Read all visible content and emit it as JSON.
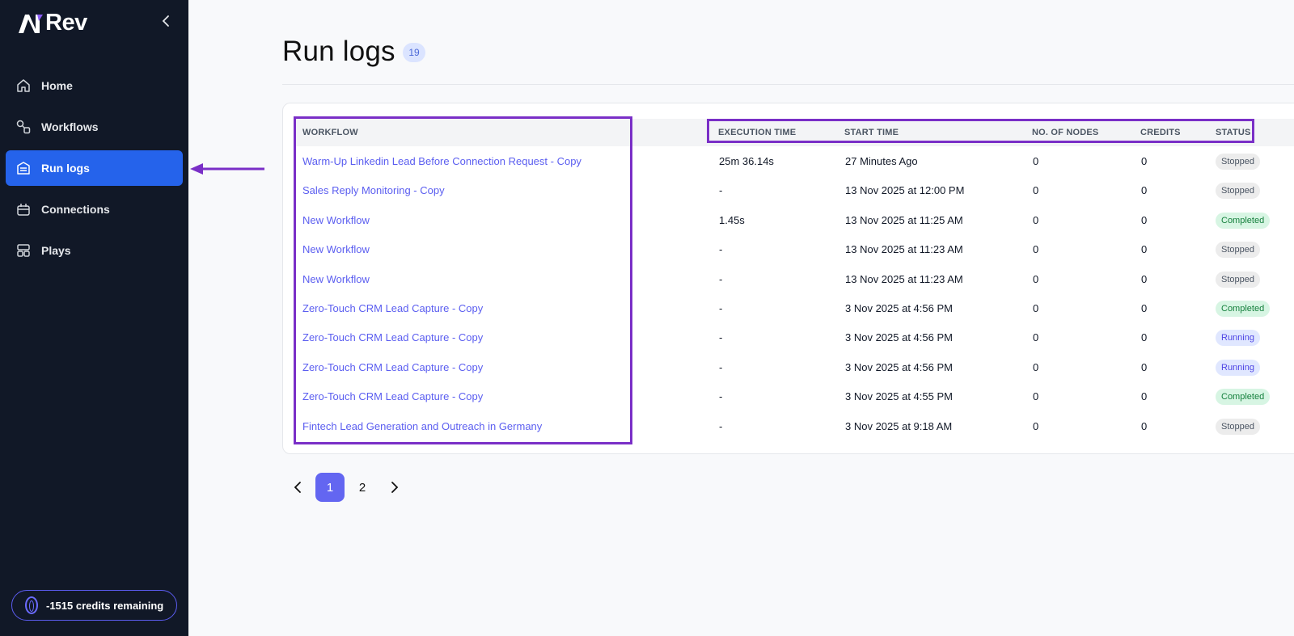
{
  "app": {
    "logo_text": "Rev"
  },
  "sidebar": {
    "items": [
      {
        "label": "Home",
        "icon": "home-icon"
      },
      {
        "label": "Workflows",
        "icon": "workflow-icon"
      },
      {
        "label": "Run logs",
        "icon": "run-logs-icon",
        "active": true
      },
      {
        "label": "Connections",
        "icon": "connections-icon"
      },
      {
        "label": "Plays",
        "icon": "plays-icon"
      }
    ],
    "credits_label": "-1515 credits remaining"
  },
  "header": {
    "title": "Run logs",
    "count": "19"
  },
  "table": {
    "columns": [
      "WORKFLOW",
      "EXECUTION TIME",
      "START TIME",
      "NO. OF NODES",
      "CREDITS",
      "STATUS"
    ],
    "rows": [
      {
        "workflow": "Warm-Up Linkedin Lead Before Connection Request - Copy",
        "execution_time": "25m 36.14s",
        "start_time": "27 Minutes Ago",
        "nodes": "0",
        "credits": "0",
        "status": "Stopped"
      },
      {
        "workflow": "Sales Reply Monitoring - Copy",
        "execution_time": "-",
        "start_time": "13 Nov 2025 at 12:00 PM",
        "nodes": "0",
        "credits": "0",
        "status": "Stopped"
      },
      {
        "workflow": "New Workflow",
        "execution_time": "1.45s",
        "start_time": "13 Nov 2025 at 11:25 AM",
        "nodes": "0",
        "credits": "0",
        "status": "Completed"
      },
      {
        "workflow": "New Workflow",
        "execution_time": "-",
        "start_time": "13 Nov 2025 at 11:23 AM",
        "nodes": "0",
        "credits": "0",
        "status": "Stopped"
      },
      {
        "workflow": "New Workflow",
        "execution_time": "-",
        "start_time": "13 Nov 2025 at 11:23 AM",
        "nodes": "0",
        "credits": "0",
        "status": "Stopped"
      },
      {
        "workflow": "Zero-Touch CRM Lead Capture - Copy",
        "execution_time": "-",
        "start_time": "3 Nov 2025 at 4:56 PM",
        "nodes": "0",
        "credits": "0",
        "status": "Completed"
      },
      {
        "workflow": "Zero-Touch CRM Lead Capture - Copy",
        "execution_time": "-",
        "start_time": "3 Nov 2025 at 4:56 PM",
        "nodes": "0",
        "credits": "0",
        "status": "Running"
      },
      {
        "workflow": "Zero-Touch CRM Lead Capture - Copy",
        "execution_time": "-",
        "start_time": "3 Nov 2025 at 4:56 PM",
        "nodes": "0",
        "credits": "0",
        "status": "Running"
      },
      {
        "workflow": "Zero-Touch CRM Lead Capture - Copy",
        "execution_time": "-",
        "start_time": "3 Nov 2025 at 4:55 PM",
        "nodes": "0",
        "credits": "0",
        "status": "Completed"
      },
      {
        "workflow": "Fintech Lead Generation and Outreach in Germany",
        "execution_time": "-",
        "start_time": "3 Nov 2025 at 9:18 AM",
        "nodes": "0",
        "credits": "0",
        "status": "Stopped"
      }
    ]
  },
  "pagination": {
    "pages": [
      "1",
      "2"
    ],
    "current": "1"
  },
  "colors": {
    "sidebar_bg": "#111827",
    "active_nav": "#2563eb",
    "link": "#5b5ef0",
    "highlight": "#7a2fc7",
    "page_active": "#6366f1"
  }
}
